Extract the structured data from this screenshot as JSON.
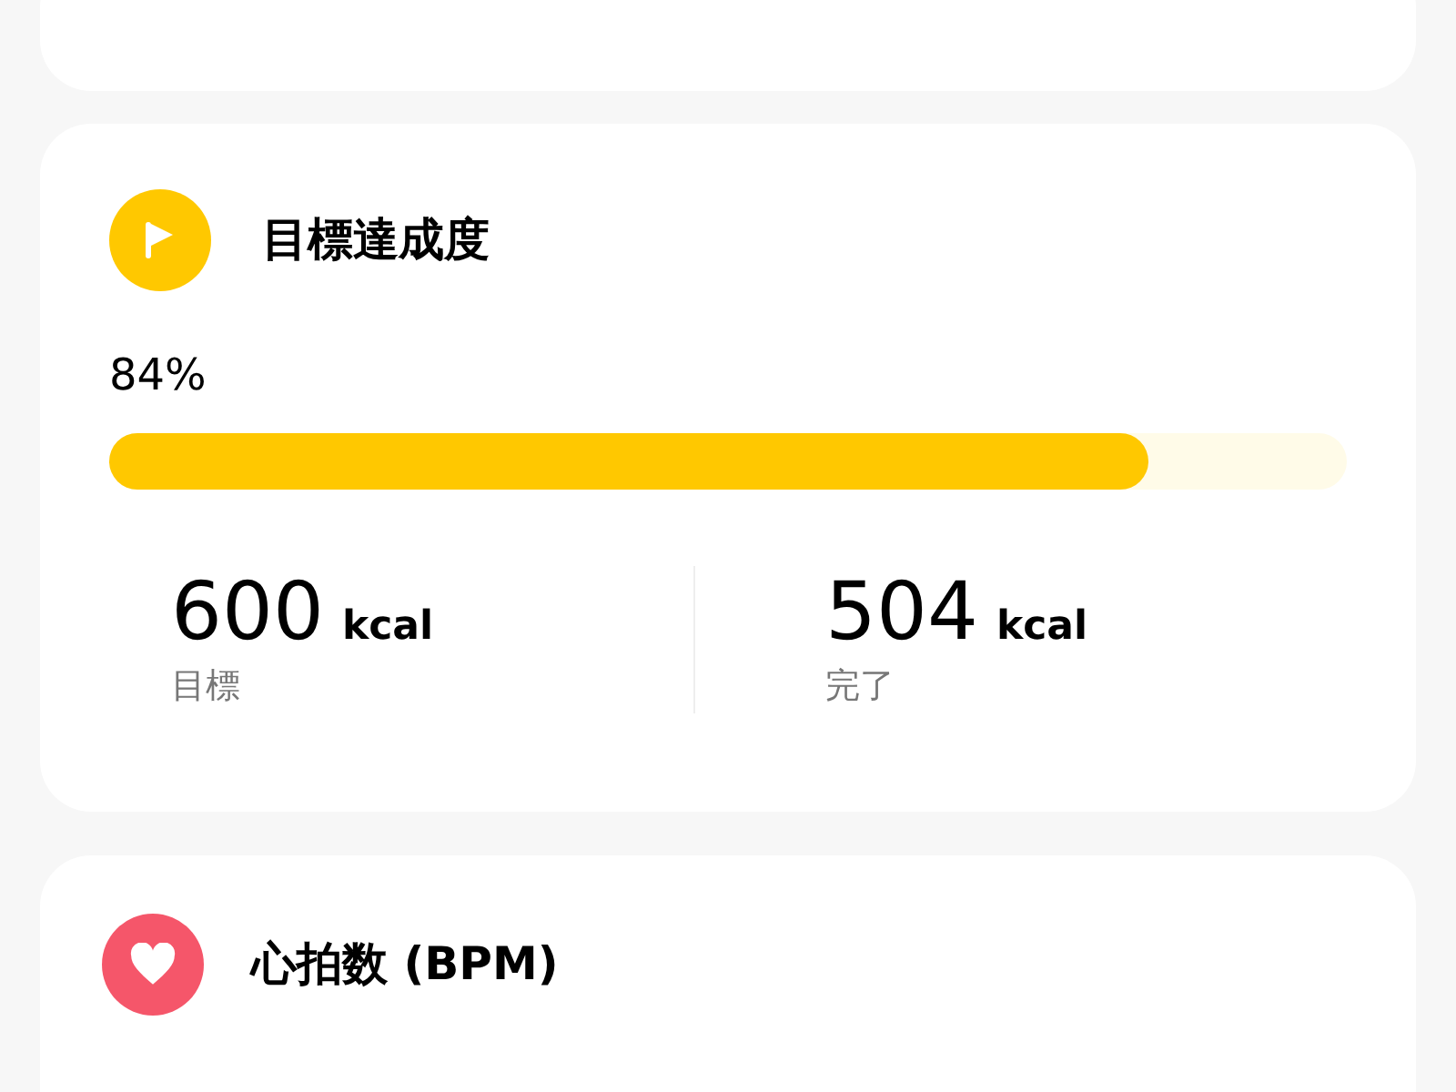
{
  "goal_card": {
    "title": "目標達成度",
    "percent": "84%",
    "level": 0.84,
    "stats": [
      {
        "value": "600",
        "unit": "kcal",
        "label": "目標"
      },
      {
        "value": "504",
        "unit": "kcal",
        "label": "完了"
      }
    ]
  },
  "heart_card": {
    "title": "心拍数 (BPM)"
  }
}
